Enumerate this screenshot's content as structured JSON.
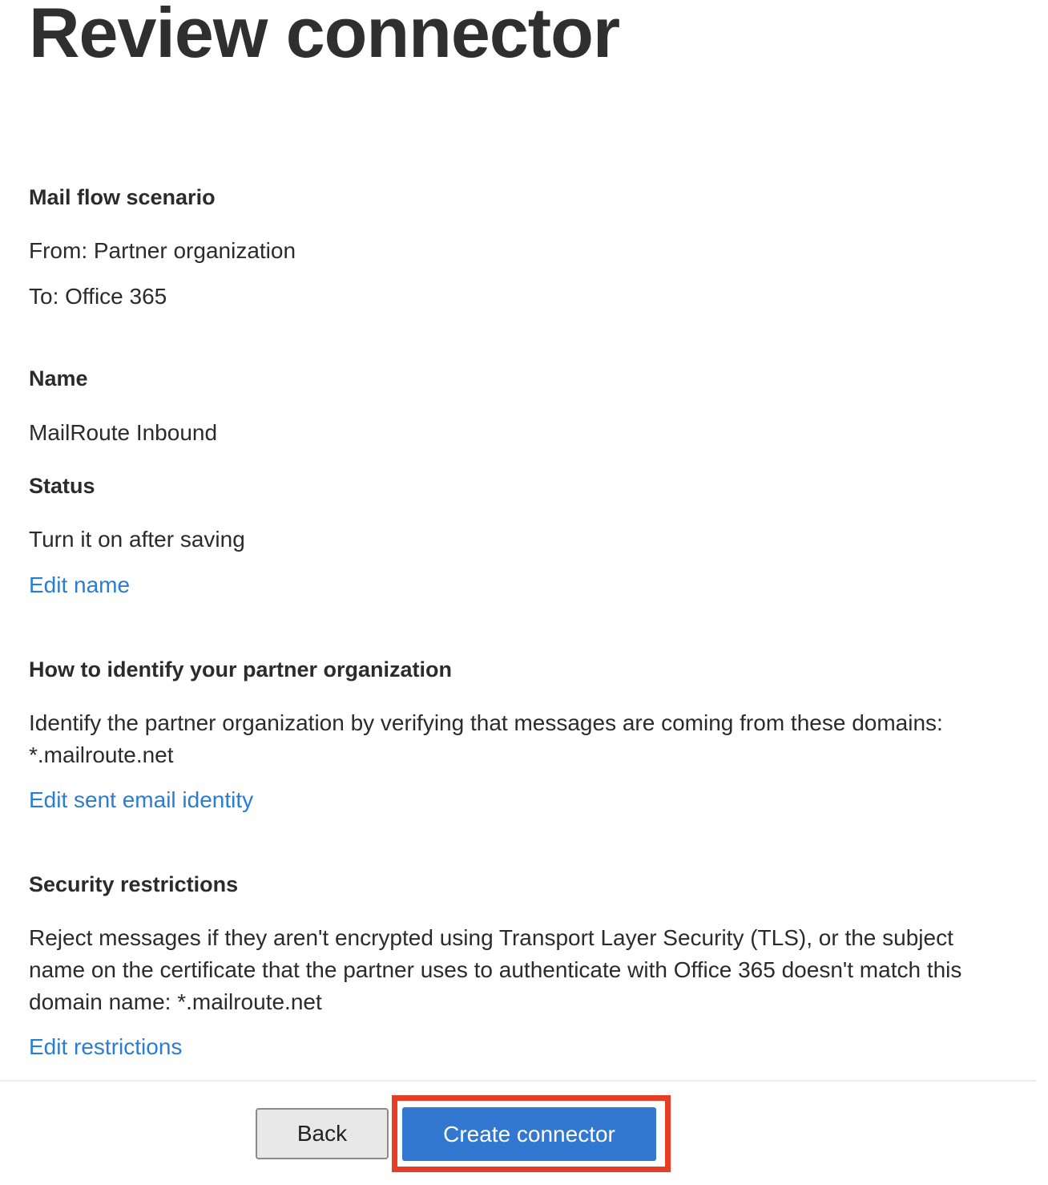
{
  "page": {
    "title": "Review connector"
  },
  "sections": {
    "scenario": {
      "heading": "Mail flow scenario",
      "from": "From: Partner organization",
      "to": "To: Office 365"
    },
    "name": {
      "heading": "Name",
      "value": "MailRoute Inbound"
    },
    "status": {
      "heading": "Status",
      "value": "Turn it on after saving",
      "edit_link": "Edit name"
    },
    "identify": {
      "heading": "How to identify your partner organization",
      "line1": "Identify the partner organization by verifying that messages are coming from these domains:",
      "line2": "*.mailroute.net",
      "edit_link": "Edit sent email identity"
    },
    "security": {
      "heading": "Security restrictions",
      "line1": "Reject messages if they aren't encrypted using Transport Layer Security (TLS), or the subject",
      "line2": "name on the certificate that the partner uses to authenticate with Office 365 doesn't match this",
      "line3": "domain name: *.mailroute.net",
      "edit_link": "Edit restrictions"
    }
  },
  "footer": {
    "back_label": "Back",
    "create_label": "Create connector"
  },
  "colors": {
    "link": "#2b7cd3",
    "primary_button": "#3277d0",
    "highlight": "#e63d24"
  }
}
